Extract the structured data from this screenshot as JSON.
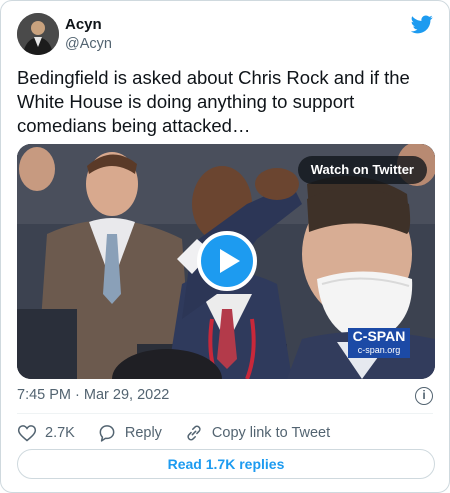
{
  "author": {
    "name": "Acyn",
    "handle": "@Acyn"
  },
  "tweet": {
    "text": "Bedingfield is asked about Chris Rock and if the White House is doing anything to support comedians being attacked…"
  },
  "media": {
    "watch_label": "Watch on Twitter",
    "watermark_brand": "C-SPAN",
    "watermark_url": "c-span.org"
  },
  "meta": {
    "timestamp": "7:45 PM · Mar 29, 2022"
  },
  "actions": {
    "likes_count": "2.7K",
    "reply_label": "Reply",
    "copy_link_label": "Copy link to Tweet"
  },
  "replies_button": {
    "label": "Read 1.7K replies"
  },
  "colors": {
    "accent": "#1d9bf0",
    "text_primary": "#0f1419",
    "text_secondary": "#536471",
    "border": "#cfd9de"
  },
  "icons": [
    "twitter-bird-icon",
    "play-icon",
    "info-icon",
    "heart-icon",
    "reply-bubble-icon",
    "link-icon"
  ]
}
